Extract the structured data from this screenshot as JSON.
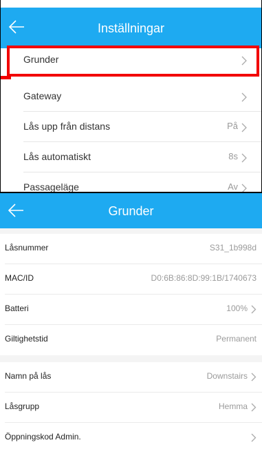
{
  "screen1": {
    "title": "Inställningar",
    "rows": [
      {
        "label": "Grunder",
        "value": ""
      },
      {
        "label": "Gateway",
        "value": ""
      },
      {
        "label": "Lås upp från distans",
        "value": "På"
      },
      {
        "label": "Lås automatiskt",
        "value": "8s"
      },
      {
        "label": "Passageläge",
        "value": "Av"
      }
    ]
  },
  "screen2": {
    "title": "Grunder",
    "rows": [
      {
        "label": "Låsnummer",
        "value": "S31_1b998d"
      },
      {
        "label": "MAC/ID",
        "value": "D0:6B:86:8D:99:1B/1740673"
      },
      {
        "label": "Batteri",
        "value": "100%"
      },
      {
        "label": "Giltighetstid",
        "value": "Permanent"
      },
      {
        "label": "Namn på lås",
        "value": "Downstairs"
      },
      {
        "label": "Låsgrupp",
        "value": "Hemma"
      },
      {
        "label": "Öppningskod Admin.",
        "value": ""
      }
    ]
  },
  "colors": {
    "accent": "#1eaaf1",
    "highlight": "#f20000"
  },
  "icons": {
    "back": "arrow-left-icon",
    "chevron": "chevron-right-icon"
  }
}
